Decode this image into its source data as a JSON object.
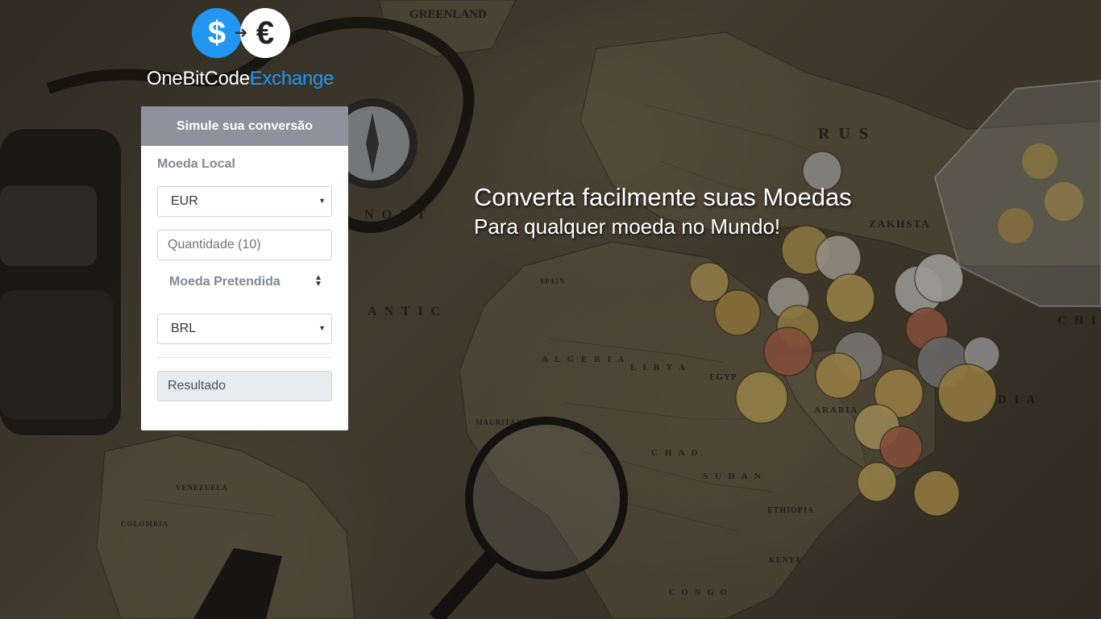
{
  "brand": {
    "name_part1": "OneBitCode",
    "name_part2": "Exchange",
    "dollar_symbol": "$",
    "euro_symbol": "€",
    "accent_color": "#2196f3"
  },
  "converter": {
    "title": "Simule sua conversão",
    "local_currency_label": "Moeda Local",
    "local_currency_value": "EUR",
    "amount_placeholder": "Quantidade (10)",
    "target_currency_label": "Moeda Pretendida",
    "target_currency_value": "BRL",
    "result_placeholder": "Resultado"
  },
  "hero": {
    "headline": "Converta facilmente suas Moedas",
    "subheadline": "Para qualquer moeda no Mundo!"
  },
  "map_labels": {
    "greenland": "GREENLAND",
    "russia": "R U S",
    "north": "N O R T",
    "atlantic": "A N T I C",
    "algeria": "A L G E R I A",
    "libya": "L I B Y A",
    "egypt": "EGYP",
    "chad": "C H A D",
    "sudan": "S U D A N",
    "ethiopia": "ETHIOPIA",
    "kenya": "KENYA",
    "congo": "C O N G O",
    "venezuela": "VENEZUELA",
    "colombia": "COLOMBIA",
    "spain": "SPAIN",
    "mauritania": "MAURITANI",
    "kazakhstan": "ZAKHSTA",
    "arabia": "ARABIA",
    "india": "D I A",
    "china": "C H I"
  }
}
